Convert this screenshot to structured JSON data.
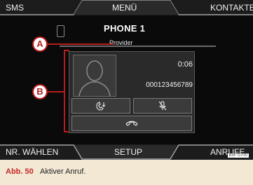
{
  "top_bar": {
    "left_tab": "SMS",
    "center_tab": "MENÜ",
    "right_tab": "KONTAKTE"
  },
  "call": {
    "title": "PHONE 1",
    "provider": "Provider",
    "duration": "0:06",
    "number": "000123456789"
  },
  "bottom_bar": {
    "left_tab": "NR. WÄHLEN",
    "center_tab": "SETUP",
    "right_tab": "ANRUFE"
  },
  "callouts": {
    "a": "A",
    "b": "B"
  },
  "figure": {
    "code": "B5F-0700",
    "label": "Abb. 50",
    "caption": "Aktiver Anruf."
  },
  "icons": {
    "phone": "phone-icon",
    "contact": "contact-silhouette-icon",
    "handset": "handset-icon",
    "mute": "microphone-mute-icon",
    "hang_up": "hang-up-icon"
  },
  "colors": {
    "screen_bg": "#0a0a0a",
    "callout": "#b71c1c",
    "caption_bg": "#f2e8d4",
    "caption_label": "#c62828"
  }
}
